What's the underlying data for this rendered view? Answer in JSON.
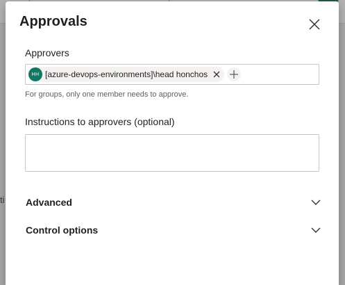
{
  "background": {
    "side_text": "ti"
  },
  "dialog": {
    "title": "Approvals",
    "approvers": {
      "label": "Approvers",
      "chips": [
        {
          "initials": "HH",
          "text": "[azure-devops-environments]\\head honchos",
          "avatar_color": "#117865"
        }
      ],
      "hint": "For groups, only one member needs to approve."
    },
    "instructions": {
      "label": "Instructions to approvers (optional)",
      "value": ""
    },
    "sections": [
      {
        "label": "Advanced",
        "icon": "chevron-down-icon"
      },
      {
        "label": "Control options",
        "icon": "chevron-down-icon"
      }
    ],
    "icons": {
      "close": "close-icon",
      "remove": "close-icon",
      "add": "plus-icon"
    }
  }
}
